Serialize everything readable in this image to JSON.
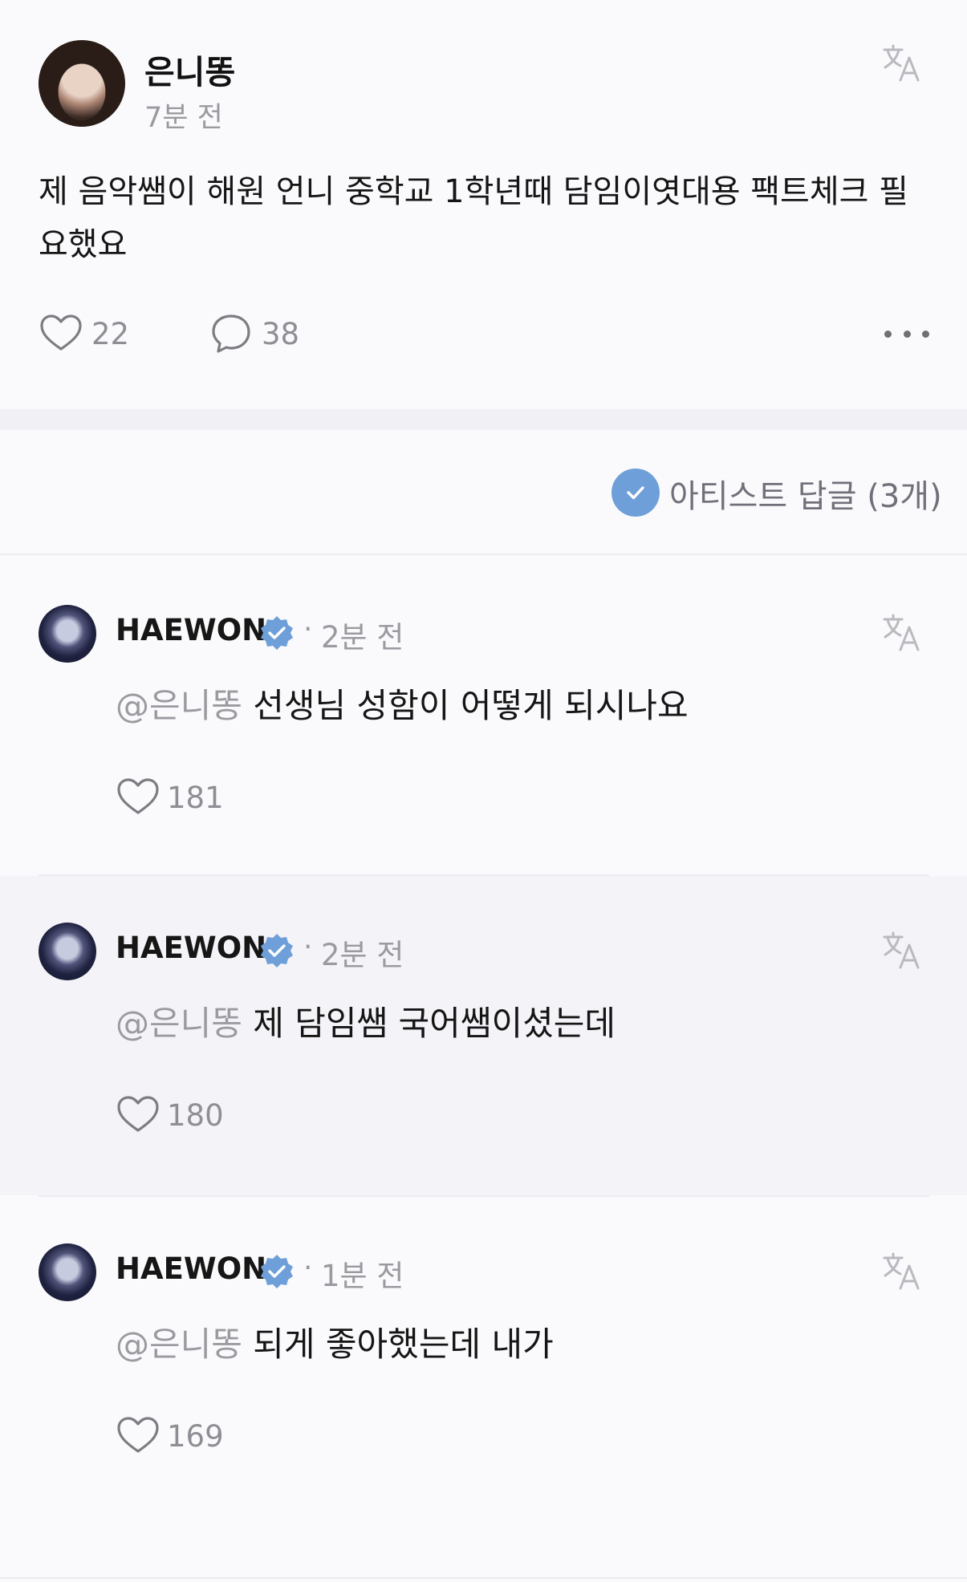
{
  "post": {
    "author": "은니똥",
    "time": "7분 전",
    "text": "제 음악쌤이 해원 언니 중학교 1학년때 담임이엿대용 팩트체크 필요했요",
    "likes": "22",
    "comments": "38"
  },
  "artist_replies": {
    "label": "아티스트 답글 (3개)",
    "badge_color": "#6f9fd8"
  },
  "comments": [
    {
      "name": "HAEWON",
      "dot": "·",
      "time": "2분 전",
      "mention": "@은니똥",
      "text": " 선생님 성함이 어떻게 되시나요",
      "likes": "181"
    },
    {
      "name": "HAEWON",
      "dot": "·",
      "time": "2분 전",
      "mention": "@은니똥",
      "text": " 제 담임쌤 국어쌤이셨는데",
      "likes": "180"
    },
    {
      "name": "HAEWON",
      "dot": "·",
      "time": "1분 전",
      "mention": "@은니똥",
      "text": " 되게 좋아했는데 내가",
      "likes": "169"
    }
  ],
  "icons": {
    "translate": "translate-icon",
    "heart": "heart-icon",
    "comment": "comment-bubble-icon",
    "more": "more-horizontal-icon",
    "verified": "verified-badge-icon"
  }
}
